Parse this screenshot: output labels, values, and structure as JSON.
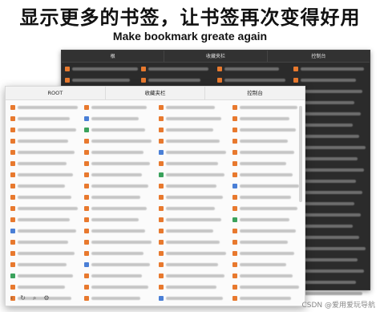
{
  "headline": "显示更多的书签，让书签再次变得好用",
  "subline": "Make bookmark  greate again",
  "dark_panel": {
    "columns": [
      "根",
      "收藏夹栏",
      "控制台"
    ]
  },
  "light_panel": {
    "columns": [
      "ROOT",
      "收藏夹栏",
      "控制台"
    ],
    "toolbar": {
      "back_icon": "‹",
      "refresh_icon": "↻",
      "search_icon": "⌕",
      "settings_icon": "⚙"
    }
  },
  "watermark": "CSDN @爱用爱玩导航",
  "colors": {
    "favicon": "#e8792e",
    "dark_bg": "#2b2b2b",
    "light_bg": "#fbfbfb"
  }
}
